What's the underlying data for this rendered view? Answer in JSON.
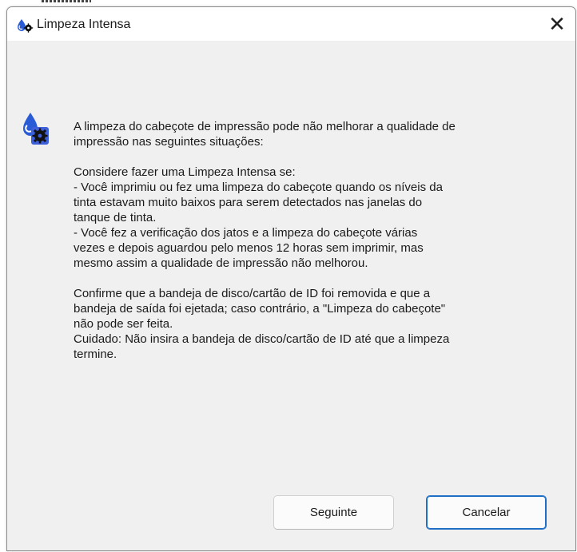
{
  "window": {
    "title": "Limpeza Intensa",
    "close_glyph": "✕"
  },
  "icons": {
    "title_icon": "ink-drop-gear-icon",
    "message_icon": "ink-drop-gear-icon"
  },
  "message": {
    "line1": "A limpeza do cabeçote de impressão pode não melhorar a qualidade de",
    "line2": "impressão nas seguintes situações:",
    "line3": "Considere fazer uma Limpeza Intensa se:",
    "line4": "- Você imprimiu ou fez uma limpeza do cabeçote quando os níveis da",
    "line5": "tinta estavam muito baixos para serem detectados nas janelas do",
    "line6": "tanque de tinta.",
    "line7": "- Você fez a verificação dos jatos e a limpeza do cabeçote várias",
    "line8": "vezes e depois aguardou pelo menos 12 horas sem imprimir, mas",
    "line9": "mesmo assim a qualidade de impressão não melhorou.",
    "line10": "Confirme que a bandeja de disco/cartão de ID foi removida e que a",
    "line11": "bandeja de saída foi ejetada; caso contrário, a \"Limpeza do cabeçote\"",
    "line12": "não pode ser feita.",
    "line13": "Cuidado: Não insira a bandeja de disco/cartão de ID até que a limpeza",
    "line14": "termine."
  },
  "buttons": {
    "next_label": "Seguinte",
    "cancel_label": "Cancelar"
  },
  "colors": {
    "dialog_bg": "#f0f0f0",
    "titlebar_bg": "#ffffff",
    "focus_accent": "#1f6fc6",
    "ink_blue": "#2a5bd7"
  }
}
